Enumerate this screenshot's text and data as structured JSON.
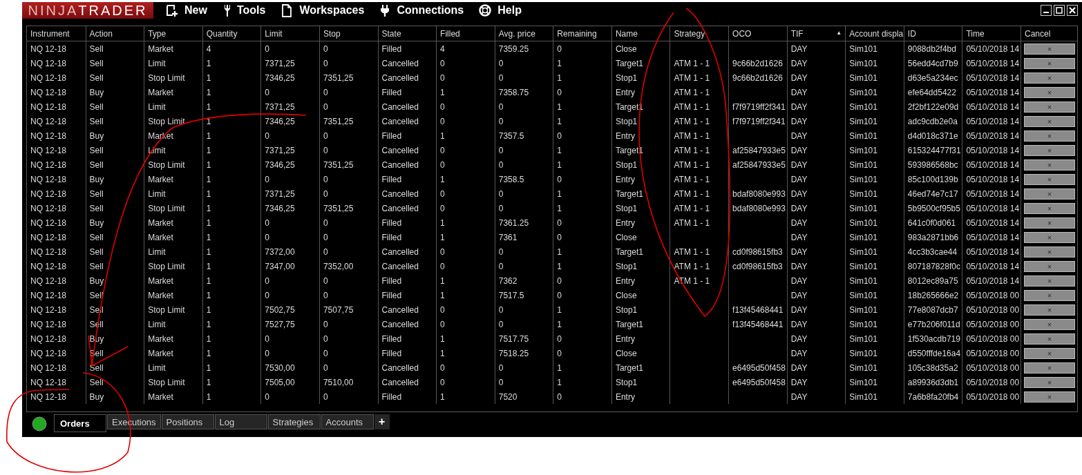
{
  "logo": "NINJA**TRADER**",
  "menu": [
    {
      "label": "New"
    },
    {
      "label": "Tools"
    },
    {
      "label": "Workspaces"
    },
    {
      "label": "Connections"
    },
    {
      "label": "Help"
    }
  ],
  "table": {
    "columns": [
      {
        "label": "Instrument"
      },
      {
        "label": "Action"
      },
      {
        "label": "Type"
      },
      {
        "label": "Quantity"
      },
      {
        "label": "Limit"
      },
      {
        "label": "Stop"
      },
      {
        "label": "State"
      },
      {
        "label": "Filled"
      },
      {
        "label": "Avg. price"
      },
      {
        "label": "Remaining"
      },
      {
        "label": "Name"
      },
      {
        "label": "Strategy"
      },
      {
        "label": "OCO"
      },
      {
        "label": "TIF",
        "sort_mark": "▲"
      },
      {
        "label": "Account displa"
      },
      {
        "label": "ID"
      },
      {
        "label": "Time"
      },
      {
        "label": "Cancel"
      }
    ],
    "rows": [
      {
        "cells": [
          "NQ 12-18",
          "Sell",
          "Market",
          "4",
          "0",
          "0",
          "Filled",
          "4",
          "7359.25",
          "0",
          "Close",
          null,
          null,
          "DAY",
          "Sim101",
          "9088db2f4bd",
          "05/10/2018 14"
        ],
        "cancel": "×"
      },
      {
        "cells": [
          "NQ 12-18",
          "Sell",
          "Limit",
          "1",
          "7371,25",
          "0",
          "Cancelled",
          "0",
          "0",
          "1",
          "Target1",
          "ATM 1 - 1",
          "9c66b2d1626",
          "DAY",
          "Sim101",
          "56edd4cd7b9",
          "05/10/2018 14"
        ],
        "cancel": "×"
      },
      {
        "cells": [
          "NQ 12-18",
          "Sell",
          "Stop Limit",
          "1",
          "7346,25",
          "7351,25",
          "Cancelled",
          "0",
          "0",
          "1",
          "Stop1",
          "ATM 1 - 1",
          "9c66b2d1626",
          "DAY",
          "Sim101",
          "d63e5a234ec",
          "05/10/2018 14"
        ],
        "cancel": "×"
      },
      {
        "cells": [
          "NQ 12-18",
          "Buy",
          "Market",
          "1",
          "0",
          "0",
          "Filled",
          "1",
          "7358.75",
          "0",
          "Entry",
          "ATM 1 - 1",
          null,
          "DAY",
          "Sim101",
          "efe64dd5422",
          "05/10/2018 14"
        ],
        "cancel": "×"
      },
      {
        "cells": [
          "NQ 12-18",
          "Sell",
          "Limit",
          "1",
          "7371,25",
          "0",
          "Cancelled",
          "0",
          "0",
          "1",
          "Target1",
          "ATM 1 - 1",
          "f7f9719ff2f341",
          "DAY",
          "Sim101",
          "2f2bf122e09d",
          "05/10/2018 14"
        ],
        "cancel": "×"
      },
      {
        "cells": [
          "NQ 12-18",
          "Sell",
          "Stop Limit",
          "1",
          "7346,25",
          "7351,25",
          "Cancelled",
          "0",
          "0",
          "1",
          "Stop1",
          "ATM 1 - 1",
          "f7f9719ff2f341",
          "DAY",
          "Sim101",
          "adc9cdb2e0a",
          "05/10/2018 14"
        ],
        "cancel": "×"
      },
      {
        "cells": [
          "NQ 12-18",
          "Buy",
          "Market",
          "1",
          "0",
          "0",
          "Filled",
          "1",
          "7357.5",
          "0",
          "Entry",
          "ATM 1 - 1",
          null,
          "DAY",
          "Sim101",
          "d4d018c371e",
          "05/10/2018 14"
        ],
        "cancel": "×"
      },
      {
        "cells": [
          "NQ 12-18",
          "Sell",
          "Limit",
          "1",
          "7371,25",
          "0",
          "Cancelled",
          "0",
          "0",
          "1",
          "Target1",
          "ATM 1 - 1",
          "af25847933e5",
          "DAY",
          "Sim101",
          "615324477f31",
          "05/10/2018 14"
        ],
        "cancel": "×"
      },
      {
        "cells": [
          "NQ 12-18",
          "Sell",
          "Stop Limit",
          "1",
          "7346,25",
          "7351,25",
          "Cancelled",
          "0",
          "0",
          "1",
          "Stop1",
          "ATM 1 - 1",
          "af25847933e5",
          "DAY",
          "Sim101",
          "593986568bc",
          "05/10/2018 14"
        ],
        "cancel": "×"
      },
      {
        "cells": [
          "NQ 12-18",
          "Buy",
          "Market",
          "1",
          "0",
          "0",
          "Filled",
          "1",
          "7358.5",
          "0",
          "Entry",
          "ATM 1 - 1",
          null,
          "DAY",
          "Sim101",
          "85c100d139b",
          "05/10/2018 14"
        ],
        "cancel": "×"
      },
      {
        "cells": [
          "NQ 12-18",
          "Sell",
          "Limit",
          "1",
          "7371,25",
          "0",
          "Cancelled",
          "0",
          "0",
          "1",
          "Target1",
          "ATM 1 - 1",
          "bdaf8080e993",
          "DAY",
          "Sim101",
          "46ed74e7c17",
          "05/10/2018 14"
        ],
        "cancel": "×"
      },
      {
        "cells": [
          "NQ 12-18",
          "Sell",
          "Stop Limit",
          "1",
          "7346,25",
          "7351,25",
          "Cancelled",
          "0",
          "0",
          "1",
          "Stop1",
          "ATM 1 - 1",
          "bdaf8080e993",
          "DAY",
          "Sim101",
          "5b9500cf95b5",
          "05/10/2018 14"
        ],
        "cancel": "×"
      },
      {
        "cells": [
          "NQ 12-18",
          "Buy",
          "Market",
          "1",
          "0",
          "0",
          "Filled",
          "1",
          "7361.25",
          "0",
          "Entry",
          "ATM 1 - 1",
          null,
          "DAY",
          "Sim101",
          "641c0f0d061",
          "05/10/2018 14"
        ],
        "cancel": "×"
      },
      {
        "cells": [
          "NQ 12-18",
          "Sell",
          "Market",
          "1",
          "0",
          "0",
          "Filled",
          "1",
          "7361",
          "0",
          "Close",
          null,
          null,
          "DAY",
          "Sim101",
          "983a2871bb6",
          "05/10/2018 14"
        ],
        "cancel": "×"
      },
      {
        "cells": [
          "NQ 12-18",
          "Sell",
          "Limit",
          "1",
          "7372,00",
          "0",
          "Cancelled",
          "0",
          "0",
          "1",
          "Target1",
          "ATM 1 - 1",
          "cd0f98615fb3",
          "DAY",
          "Sim101",
          "4cc3b3cae44",
          "05/10/2018 14"
        ],
        "cancel": "×"
      },
      {
        "cells": [
          "NQ 12-18",
          "Sell",
          "Stop Limit",
          "1",
          "7347,00",
          "7352,00",
          "Cancelled",
          "0",
          "0",
          "1",
          "Stop1",
          "ATM 1 - 1",
          "cd0f98615fb3",
          "DAY",
          "Sim101",
          "807187828f0c",
          "05/10/2018 14"
        ],
        "cancel": "×"
      },
      {
        "cells": [
          "NQ 12-18",
          "Buy",
          "Market",
          "1",
          "0",
          "0",
          "Filled",
          "1",
          "7362",
          "0",
          "Entry",
          "ATM 1 - 1",
          null,
          "DAY",
          "Sim101",
          "8012ec89a75",
          "05/10/2018 14"
        ],
        "cancel": "×"
      },
      {
        "cells": [
          "NQ 12-18",
          "Sell",
          "Market",
          "1",
          "0",
          "0",
          "Filled",
          "1",
          "7517.5",
          "0",
          "Close",
          null,
          null,
          "DAY",
          "Sim101",
          "18b265666e2",
          "05/10/2018 00"
        ],
        "cancel": "×"
      },
      {
        "cells": [
          "NQ 12-18",
          "Sell",
          "Stop Limit",
          "1",
          "7502,75",
          "7507,75",
          "Cancelled",
          "0",
          "0",
          "1",
          "Stop1",
          null,
          "f13f45468441",
          "DAY",
          "Sim101",
          "77e8087dcb7",
          "05/10/2018 00"
        ],
        "cancel": "×"
      },
      {
        "cells": [
          "NQ 12-18",
          "Sell",
          "Limit",
          "1",
          "7527,75",
          "0",
          "Cancelled",
          "0",
          "0",
          "1",
          "Target1",
          null,
          "f13f45468441",
          "DAY",
          "Sim101",
          "e77b206f011d",
          "05/10/2018 00"
        ],
        "cancel": "×"
      },
      {
        "cells": [
          "NQ 12-18",
          "Buy",
          "Market",
          "1",
          "0",
          "0",
          "Filled",
          "1",
          "7517.75",
          "0",
          "Entry",
          null,
          null,
          "DAY",
          "Sim101",
          "1f530acdb719",
          "05/10/2018 00"
        ],
        "cancel": "×"
      },
      {
        "cells": [
          "NQ 12-18",
          "Sell",
          "Market",
          "1",
          "0",
          "0",
          "Filled",
          "1",
          "7518.25",
          "0",
          "Close",
          null,
          null,
          "DAY",
          "Sim101",
          "d550fffde16a4",
          "05/10/2018 00"
        ],
        "cancel": "×"
      },
      {
        "cells": [
          "NQ 12-18",
          "Sell",
          "Limit",
          "1",
          "7530,00",
          "0",
          "Cancelled",
          "0",
          "0",
          "1",
          "Target1",
          null,
          "e6495d50f458",
          "DAY",
          "Sim101",
          "105c38d35a2",
          "05/10/2018 00"
        ],
        "cancel": "×"
      },
      {
        "cells": [
          "NQ 12-18",
          "Sell",
          "Stop Limit",
          "1",
          "7505,00",
          "7510,00",
          "Cancelled",
          "0",
          "0",
          "1",
          "Stop1",
          null,
          "e6495d50f458",
          "DAY",
          "Sim101",
          "a89936d3db1",
          "05/10/2018 00"
        ],
        "cancel": "×"
      },
      {
        "cells": [
          "NQ 12-18",
          "Buy",
          "Market",
          "1",
          "0",
          "0",
          "Filled",
          "1",
          "7520",
          "0",
          "Entry",
          null,
          null,
          "DAY",
          "Sim101",
          "7a6b8fa20fb4",
          "05/10/2018 00"
        ],
        "cancel": "×"
      }
    ]
  },
  "tabs": [
    {
      "label": "Orders",
      "selected": true
    },
    {
      "label": "Executions",
      "selected": false
    },
    {
      "label": "Positions",
      "selected": false
    },
    {
      "label": "Log",
      "selected": false
    },
    {
      "label": "Strategies",
      "selected": false
    },
    {
      "label": "Accounts",
      "selected": false
    }
  ],
  "add_tab": "+"
}
